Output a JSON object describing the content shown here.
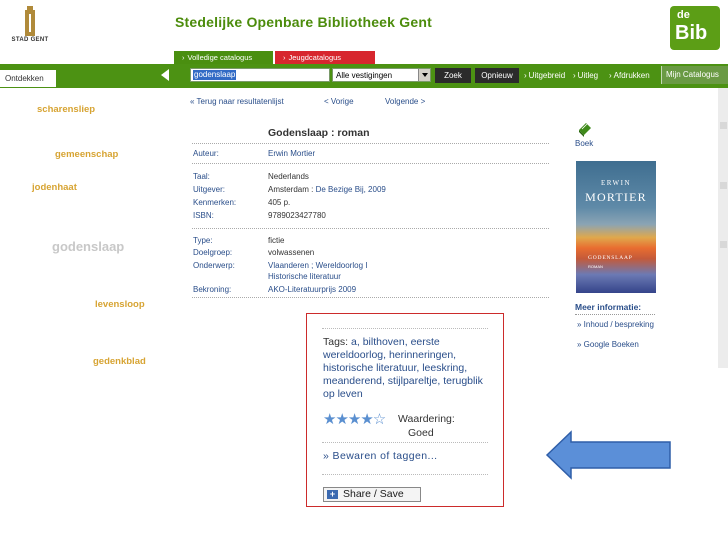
{
  "header": {
    "logo_text": "STAD GENT",
    "site_title": "Stedelijke Openbare Bibliotheek Gent",
    "debib_de": "de",
    "debib_bib": "Bib"
  },
  "catalogue_tabs": {
    "full": "Volledige catalogus",
    "youth": "Jeugdcatalogus"
  },
  "toolbar": {
    "discover": "Ontdekken",
    "search_value": "godenslaap",
    "branch": "Alle vestigingen",
    "search_button": "Zoek",
    "reset_button": "Opnieuw",
    "advanced": "Uitgebreid",
    "explain": "Uitleg",
    "print": "Afdrukken",
    "my_catalogue": "Mijn Catalogus"
  },
  "tag_cloud": [
    "scharensliep",
    "gemeenschap",
    "jodenhaat",
    "godenslaap",
    "levensloop",
    "gedenkblad"
  ],
  "nav": {
    "back": "« Terug naar resultatenlijst",
    "previous": "< Vorige",
    "next": "Volgende >"
  },
  "record": {
    "title": "Godenslaap : roman",
    "author_label": "Auteur:",
    "author": "Erwin Mortier",
    "language_label": "Taal:",
    "language": "Nederlands",
    "publisher_label": "Uitgever:",
    "publisher_place": "Amsterdam :",
    "publisher_name": "De Bezige Bij, 2009",
    "features_label": "Kenmerken:",
    "features": "405 p.",
    "isbn_label": "ISBN:",
    "isbn": "9789023427780",
    "type_label": "Type:",
    "type": "fictie",
    "audience_label": "Doelgroep:",
    "audience": "volwassenen",
    "subject_label": "Onderwerp:",
    "subject_1": "Vlaanderen ; Wereldoorlog I",
    "subject_2": "Historische literatuur",
    "award_label": "Bekroning:",
    "award": "AKO-Literatuurprijs 2009"
  },
  "side": {
    "format": "Boek",
    "cover_author": "ERWIN",
    "cover_surname": "MORTIER",
    "cover_title": "GODENSLAAP",
    "cover_sub": "ROMAN",
    "more_info": "Meer informatie:",
    "content_link": "» Inhoud / bespreking",
    "google_link": "» Google Boeken"
  },
  "tags_box": {
    "tags_label": "Tags:",
    "tags": "a, bilthoven, eerste wereldoorlog, herinneringen, historische literatuur, leeskring, meanderend, stijlpareltje, terugblik op leven",
    "stars": "★★★★☆",
    "rating_label": "Waardering:",
    "rating_value": "Goed",
    "save_link": "» Bewaren of taggen...",
    "share_button": "Share / Save",
    "share_icon": "+"
  },
  "colors": {
    "green": "#4c9213",
    "red": "#d7262e",
    "link_blue": "#2a4e8a",
    "arrow_blue": "#5b8fd8"
  }
}
